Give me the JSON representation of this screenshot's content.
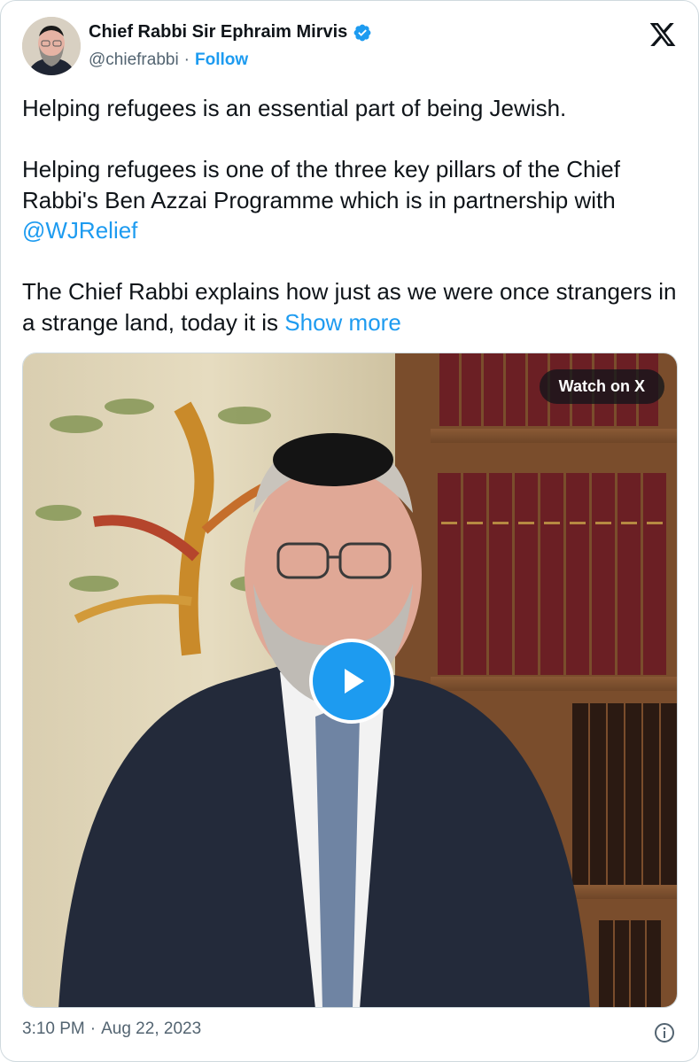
{
  "author": {
    "name": "Chief Rabbi Sir Ephraim Mirvis",
    "handle": "@chiefrabbi",
    "separator": "·",
    "follow_label": "Follow",
    "verified_color": "#1d9bf0"
  },
  "post": {
    "line1": "Helping refugees is an essential part of being Jewish.",
    "line2_text": "Helping refugees is one of the three key pillars of the Chief Rabbi's Ben Azzai Programme which is in partnership with",
    "line2_mention": "@WJRelief",
    "line3_text": "The Chief Rabbi explains how just as we were once strangers in a strange land, today it is",
    "show_more": "Show more"
  },
  "media": {
    "watch_label": "Watch on X",
    "play_icon": "play-icon"
  },
  "footer": {
    "time": "3:10 PM",
    "separator": "·",
    "date": "Aug 22, 2023",
    "info_icon": "info-icon"
  },
  "colors": {
    "accent": "#1d9bf0",
    "text": "#0f1419",
    "muted": "#536471"
  }
}
